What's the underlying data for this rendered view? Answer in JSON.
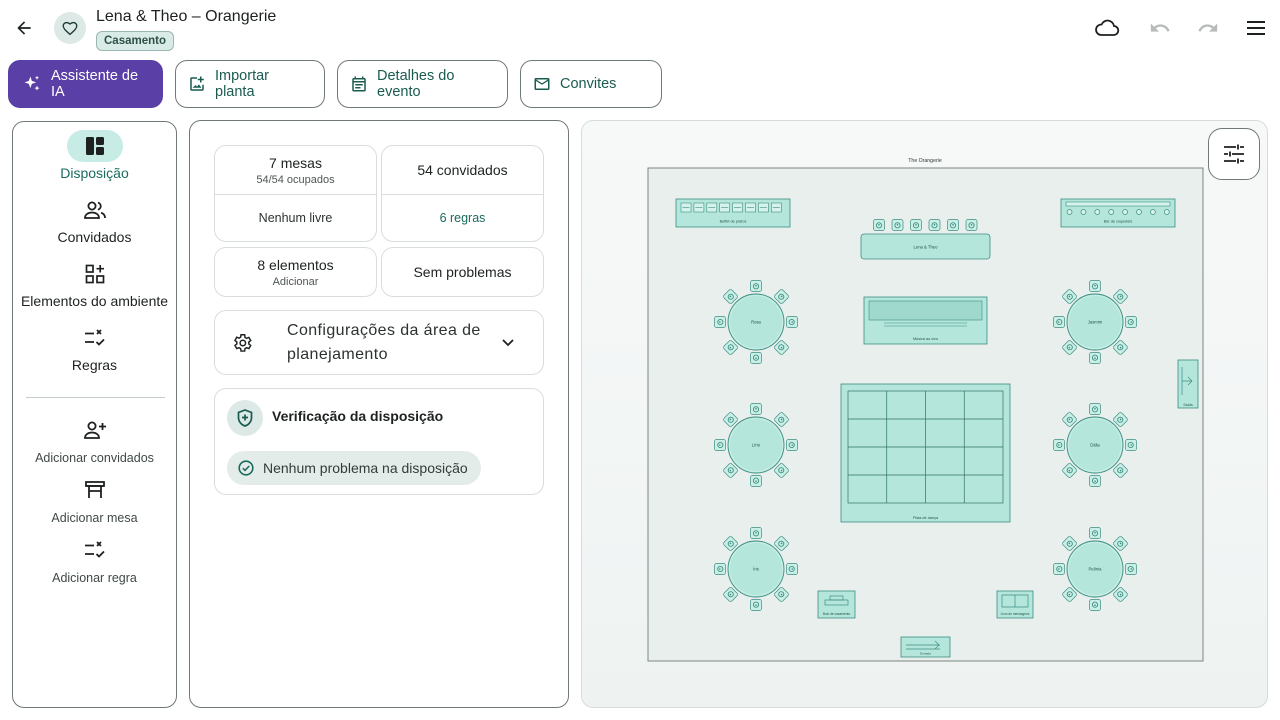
{
  "header": {
    "title": "Lena & Theo – Orangerie",
    "chip": "Casamento"
  },
  "toolbar": {
    "ai_label": "Assistente de IA",
    "import_label": "Importar planta",
    "details_label": "Detalhes do evento",
    "invites_label": "Convites"
  },
  "rail": {
    "layout": "Disposição",
    "guests": "Convidados",
    "elements": "Elementos do ambiente",
    "rules": "Regras",
    "add_guests": "Adicionar convidados",
    "add_table": "Adicionar mesa",
    "add_rule": "Adicionar regra"
  },
  "stats": {
    "tables": "7 mesas",
    "occupied": "54/54 ocupados",
    "free": "Nenhum livre",
    "guests": "54 convidados",
    "rules": "6 regras",
    "elements": "8 elementos",
    "add": "Adicionar",
    "problems": "Sem problemas"
  },
  "config": {
    "label": "Configurações da área de planejamento"
  },
  "check": {
    "title": "Verificação da disposição",
    "status": "Nenhum problema na disposição"
  },
  "floorplan": {
    "venue": "The Orangerie",
    "buffet": "Buffet de pratos",
    "bar": "Bar de coquetéis",
    "head_table": "Lena & Theo",
    "stage": "Música ao vivo",
    "dance": "Pista de dança",
    "exit": "Saída",
    "cake": "Bolo de casamento",
    "guestbook": "Livro de mensagens",
    "entrance": "Entrada",
    "tables": [
      "Rosa",
      "Jasmim",
      "Lírio",
      "Dália",
      "Íris",
      "Peônia"
    ]
  },
  "colors": {
    "primary": "#5a3fa6",
    "accent": "#1a6b5e",
    "element_fill": "#b5e6dc",
    "element_stroke": "#3c8d80"
  }
}
